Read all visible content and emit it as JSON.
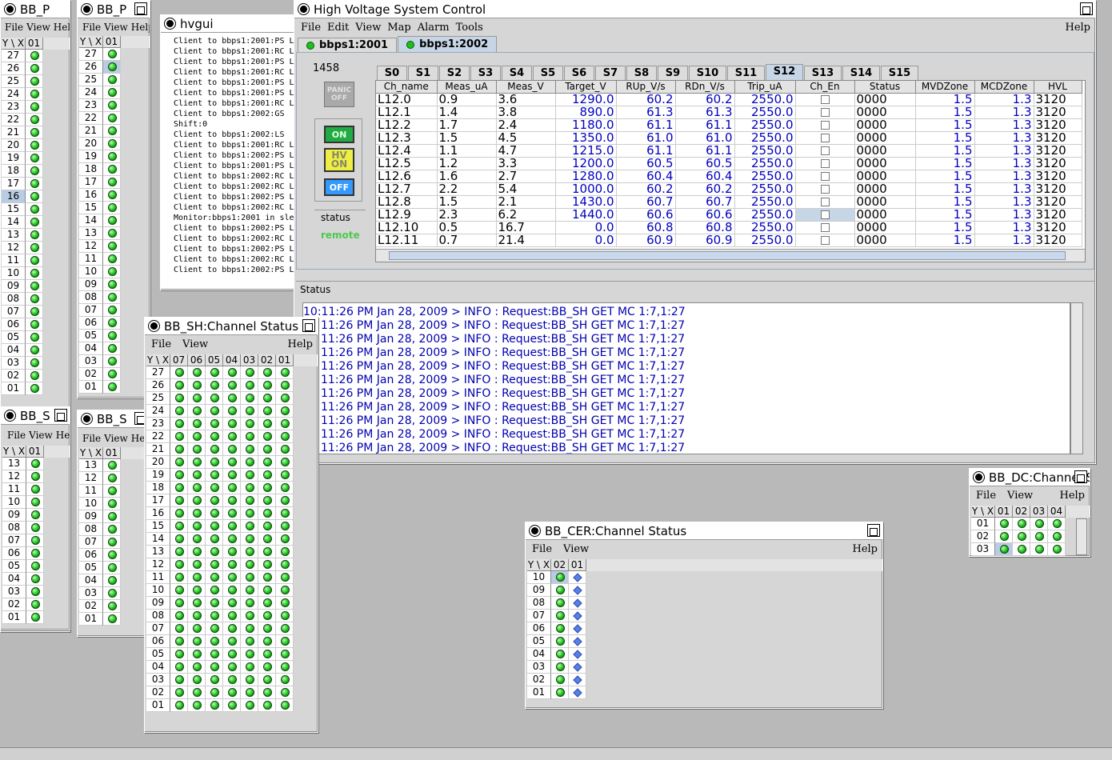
{
  "hv": {
    "title": "High Voltage System Control",
    "menu": [
      "File",
      "Edit",
      "View",
      "Map",
      "Alarm",
      "Tools"
    ],
    "help": "Help",
    "hosts": [
      "bbps1:2001",
      "bbps1:2002"
    ],
    "crate_num": "1458",
    "slots": [
      "S0",
      "S1",
      "S2",
      "S3",
      "S4",
      "S5",
      "S6",
      "S7",
      "S8",
      "S9",
      "S10",
      "S11",
      "S12",
      "S13",
      "S14",
      "S15"
    ],
    "active_slot": "S12",
    "buttons": {
      "panic": "PANIC OFF",
      "on": "ON",
      "hv_on": "HV ON",
      "off": "OFF"
    },
    "status_label": "status",
    "status_value": "remote",
    "columns": [
      "Ch_name",
      "Meas_uA",
      "Meas_V",
      "Target_V",
      "RUp_V/s",
      "RDn_V/s",
      "Trip_uA",
      "Ch_En",
      "Status",
      "MVDZone",
      "MCDZone",
      "HVL"
    ],
    "rows": [
      [
        "L12.0",
        "0.9",
        "3.6",
        "1290.0",
        "60.2",
        "60.2",
        "2550.0",
        "0000",
        "1.5",
        "1.3",
        "3120"
      ],
      [
        "L12.1",
        "1.4",
        "3.8",
        "890.0",
        "61.3",
        "61.3",
        "2550.0",
        "0000",
        "1.5",
        "1.3",
        "3120"
      ],
      [
        "L12.2",
        "1.7",
        "2.4",
        "1180.0",
        "61.1",
        "61.1",
        "2550.0",
        "0000",
        "1.5",
        "1.3",
        "3120"
      ],
      [
        "L12.3",
        "1.5",
        "4.5",
        "1350.0",
        "61.0",
        "61.0",
        "2550.0",
        "0000",
        "1.5",
        "1.3",
        "3120"
      ],
      [
        "L12.4",
        "1.1",
        "4.7",
        "1215.0",
        "61.1",
        "61.1",
        "2550.0",
        "0000",
        "1.5",
        "1.3",
        "3120"
      ],
      [
        "L12.5",
        "1.2",
        "3.3",
        "1200.0",
        "60.5",
        "60.5",
        "2550.0",
        "0000",
        "1.5",
        "1.3",
        "3120"
      ],
      [
        "L12.6",
        "1.6",
        "2.7",
        "1280.0",
        "60.4",
        "60.4",
        "2550.0",
        "0000",
        "1.5",
        "1.3",
        "3120"
      ],
      [
        "L12.7",
        "2.2",
        "5.4",
        "1000.0",
        "60.2",
        "60.2",
        "2550.0",
        "0000",
        "1.5",
        "1.3",
        "3120"
      ],
      [
        "L12.8",
        "1.5",
        "2.1",
        "1430.0",
        "60.7",
        "60.7",
        "2550.0",
        "0000",
        "1.5",
        "1.3",
        "3120"
      ],
      [
        "L12.9",
        "2.3",
        "6.2",
        "1440.0",
        "60.6",
        "60.6",
        "2550.0",
        "0000",
        "1.5",
        "1.3",
        "3120"
      ],
      [
        "L12.10",
        "0.5",
        "16.7",
        "0.0",
        "60.8",
        "60.8",
        "2550.0",
        "0000",
        "1.5",
        "1.3",
        "3120"
      ],
      [
        "L12.11",
        "0.7",
        "21.4",
        "0.0",
        "60.9",
        "60.9",
        "2550.0",
        "0000",
        "1.5",
        "1.3",
        "3120"
      ]
    ],
    "status_title": "Status",
    "log": [
      "10:11:26 PM Jan 28, 2009 > INFO : Request:BB_SH GET MC 1:7,1:27",
      "11:26 PM Jan 28, 2009 > INFO : Request:BB_SH GET MC 1:7,1:27",
      "11:26 PM Jan 28, 2009 > INFO : Request:BB_SH GET MC 1:7,1:27",
      "11:26 PM Jan 28, 2009 > INFO : Request:BB_SH GET MC 1:7,1:27",
      "11:26 PM Jan 28, 2009 > INFO : Request:BB_SH GET MC 1:7,1:27",
      "11:26 PM Jan 28, 2009 > INFO : Request:BB_SH GET MC 1:7,1:27",
      "11:26 PM Jan 28, 2009 > INFO : Request:BB_SH GET MC 1:7,1:27",
      "11:26 PM Jan 28, 2009 > INFO : Request:BB_SH GET MC 1:7,1:27",
      "11:26 PM Jan 28, 2009 > INFO : Request:BB_SH GET MC 1:7,1:27",
      "11:26 PM Jan 28, 2009 > INFO : Request:BB_SH GET MC 1:7,1:27",
      "11:26 PM Jan 28, 2009 > INFO : Request:BB_SH GET MC 1:7,1:27"
    ]
  },
  "hvgui": {
    "title": "hvgui",
    "lines": [
      "Client to bbps1:2001:PS L",
      "Client to bbps1:2001:RC L",
      "Client to bbps1:2001:PS L",
      "Client to bbps1:2001:RC L",
      "Client to bbps1:2001:PS L",
      "Client to bbps1:2001:PS L",
      "Client to bbps1:2001:RC L",
      "Client to bbps1:2002:GS",
      "Shift:0",
      "Client to bbps1:2002:LS",
      "Client to bbps1:2001:RC L",
      "Client to bbps1:2002:PS L",
      "Client to bbps1:2001:PS L",
      "Client to bbps1:2002:RC L",
      "Client to bbps1:2002:RC L",
      "Client to bbps1:2002:PS L",
      "Client to bbps1:2002:RC L",
      "Monitor:bbps1:2001 in sle",
      "Client to bbps1:2002:PS L",
      "Client to bbps1:2002:RC L",
      "Client to bbps1:2002:PS L",
      "Client to bbps1:2002:RC L",
      "Client to bbps1:2002:PS L"
    ]
  },
  "ch_windows": {
    "corner": "Y \\ X",
    "file": "File",
    "view": "View",
    "help": "Help",
    "bb_p1": {
      "title": "BB_P",
      "menu_file": "File",
      "menu_view": "View",
      "menu_help": "Help",
      "cols": [
        "01"
      ],
      "rows": [
        "27",
        "26",
        "25",
        "24",
        "23",
        "22",
        "21",
        "20",
        "19",
        "18",
        "17",
        "16",
        "15",
        "14",
        "13",
        "12",
        "11",
        "10",
        "09",
        "08",
        "07",
        "06",
        "05",
        "04",
        "03",
        "02",
        "01"
      ]
    },
    "bb_p2": {
      "title": "BB_P",
      "menu_file": "File",
      "menu_view": "View",
      "menu_help": "Help",
      "cols": [
        "01"
      ],
      "rows": [
        "27",
        "26",
        "25",
        "24",
        "23",
        "22",
        "21",
        "20",
        "19",
        "18",
        "17",
        "16",
        "15",
        "14",
        "13",
        "12",
        "11",
        "10",
        "09",
        "08",
        "07",
        "06",
        "05",
        "04",
        "03",
        "02",
        "01"
      ]
    },
    "bb_s1": {
      "title": "BB_S",
      "menu_file": "File",
      "menu_view": "View",
      "menu_help": "Help",
      "cols": [
        "01"
      ],
      "rows": [
        "13",
        "12",
        "11",
        "10",
        "09",
        "08",
        "07",
        "06",
        "05",
        "04",
        "03",
        "02",
        "01"
      ]
    },
    "bb_s2": {
      "title": "BB_S",
      "menu_file": "File",
      "menu_view": "View",
      "menu_help": "Help",
      "cols": [
        "01"
      ],
      "rows": [
        "13",
        "12",
        "11",
        "10",
        "09",
        "08",
        "07",
        "06",
        "05",
        "04",
        "03",
        "02",
        "01"
      ]
    },
    "bb_sh": {
      "title": "BB_SH:Channel Status",
      "cols": [
        "07",
        "06",
        "05",
        "04",
        "03",
        "02",
        "01"
      ],
      "rows": [
        "27",
        "26",
        "25",
        "24",
        "23",
        "22",
        "21",
        "20",
        "19",
        "18",
        "17",
        "16",
        "15",
        "14",
        "13",
        "12",
        "11",
        "10",
        "09",
        "08",
        "07",
        "06",
        "05",
        "04",
        "03",
        "02",
        "01"
      ]
    },
    "bb_cer": {
      "title": "BB_CER:Channel Status",
      "cols": [
        "02",
        "01"
      ],
      "rows": [
        "10",
        "09",
        "08",
        "07",
        "06",
        "05",
        "04",
        "03",
        "02",
        "01"
      ]
    },
    "bb_dc": {
      "title": "BB_DC:Channel Status",
      "cols": [
        "01",
        "02",
        "03",
        "04"
      ],
      "rows": [
        "01",
        "02",
        "03"
      ]
    }
  }
}
